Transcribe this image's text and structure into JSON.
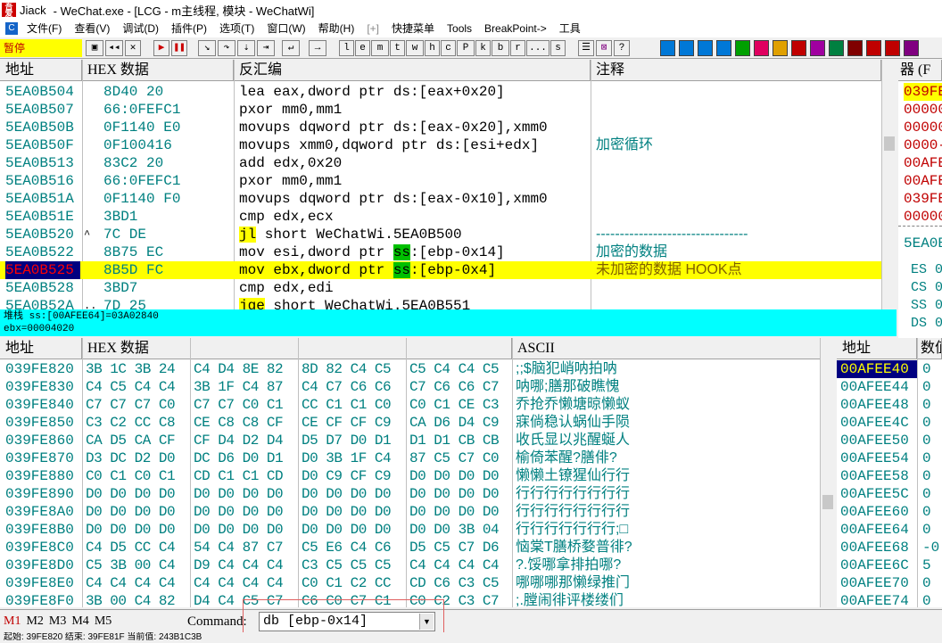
{
  "title": {
    "app": "Jiack",
    "text": "- WeChat.exe - [LCG - m主线程, 模块 - WeChatWi]"
  },
  "menu": [
    {
      "label": "文件(F)"
    },
    {
      "label": "查看(V)"
    },
    {
      "label": "调试(D)"
    },
    {
      "label": "插件(P)"
    },
    {
      "label": "选项(T)"
    },
    {
      "label": "窗口(W)"
    },
    {
      "label": "帮助(H)"
    },
    {
      "label": "[+]"
    },
    {
      "label": "快捷菜单"
    },
    {
      "label": "Tools"
    },
    {
      "label": "BreakPoint->"
    },
    {
      "label": "工具"
    }
  ],
  "toolbar": {
    "pause_label": "暂停",
    "letters": [
      "l",
      "e",
      "m",
      "t",
      "w",
      "h",
      "c",
      "P",
      "k",
      "b",
      "r",
      "...",
      "s"
    ],
    "color_buttons": [
      "#0078d7",
      "#0078d7",
      "#0078d7",
      "#0078d7",
      "#00a000",
      "#e00060",
      "#e0a000",
      "#c00000",
      "#a000a0",
      "#008040",
      "#800000",
      "#c00000",
      "#c00000",
      "#800080"
    ]
  },
  "disasm": {
    "headers": {
      "addr": "地址",
      "hex": "HEX 数据",
      "dis": "反汇编",
      "cmt": "注释"
    },
    "rows": [
      {
        "addr": "5EA0B504",
        "mark": "",
        "hex": "8D40 20",
        "dis": "lea eax,dword ptr ds:[eax+0x20]",
        "cmt": ""
      },
      {
        "addr": "5EA0B507",
        "mark": "",
        "hex": "66:0FEFC1",
        "dis": "pxor mm0,mm1",
        "cmt": ""
      },
      {
        "addr": "5EA0B50B",
        "mark": "",
        "hex": "0F1140 E0",
        "dis": "movups dqword ptr ds:[eax-0x20],xmm0",
        "cmt": ""
      },
      {
        "addr": "5EA0B50F",
        "mark": "",
        "hex": "0F100416",
        "dis": "movups xmm0,dqword ptr ds:[esi+edx]",
        "cmt": "加密循环"
      },
      {
        "addr": "5EA0B513",
        "mark": "",
        "hex": "83C2 20",
        "dis": "add edx,0x20",
        "cmt": ""
      },
      {
        "addr": "5EA0B516",
        "mark": "",
        "hex": "66:0FEFC1",
        "dis": "pxor mm0,mm1",
        "cmt": ""
      },
      {
        "addr": "5EA0B51A",
        "mark": "",
        "hex": "0F1140 F0",
        "dis": "movups dqword ptr ds:[eax-0x10],xmm0",
        "cmt": ""
      },
      {
        "addr": "5EA0B51E",
        "mark": "",
        "hex": "3BD1",
        "dis": "cmp edx,ecx",
        "cmt": ""
      },
      {
        "addr": "5EA0B520",
        "mark": "^",
        "hex": "7C DE",
        "dis_op": "jl",
        "dis_rest": " short WeChatWi.5EA0B500",
        "cmt": "--------------------------------"
      },
      {
        "addr": "5EA0B522",
        "mark": "",
        "hex": "8B75 EC",
        "dis_pre": "mov esi,dword ptr ",
        "dis_seg": "ss",
        "dis_post": ":[ebp-0x14]",
        "cmt": "加密的数据"
      },
      {
        "addr": "5EA0B525",
        "mark": "",
        "hex": "8B5D FC",
        "dis_pre": "mov ebx,dword ptr ",
        "dis_seg": "ss",
        "dis_post": ":[ebp-0x4]",
        "cmt": "未加密的数据 HOOK点",
        "selected": true
      },
      {
        "addr": "5EA0B528",
        "mark": "",
        "hex": "3BD7",
        "dis": "cmp edx,edi",
        "cmt": ""
      },
      {
        "addr": "5EA0B52A",
        "mark": "..",
        "hex": "7D 25",
        "dis_op": "jge",
        "dis_rest": " short WeChatWi.5EA0B551",
        "cmt": ""
      }
    ]
  },
  "info": {
    "line1": "堆栈 ss:[00AFEE64]=03A02840",
    "line2": "ebx=00004020"
  },
  "registers": {
    "header": "器 (F",
    "values": [
      {
        "text": "039FE",
        "color": "#c00000",
        "bg": "#ffff00"
      },
      {
        "text": "00000",
        "color": "#c00000"
      },
      {
        "text": "00000",
        "color": "#c00000"
      },
      {
        "text": "0000-",
        "color": "#c00000"
      },
      {
        "text": "00AFE",
        "color": "#c00000"
      },
      {
        "text": "00AFE",
        "color": "#c00000"
      },
      {
        "text": "039FE",
        "color": "#c00000"
      },
      {
        "text": "00000",
        "color": "#c00000"
      }
    ],
    "eip": "5EA0B",
    "segs": [
      "ES 0",
      "CS 0",
      "SS 0",
      "DS 0"
    ]
  },
  "dump": {
    "headers": {
      "addr": "地址",
      "hex": "HEX 数据",
      "ascii": "ASCII"
    },
    "rows": [
      {
        "addr": "039FE820",
        "hex": [
          "3B 1C 3B 24",
          "C4 D4 8E 82",
          "8D 82 C4 C5",
          "C5 C4 C4 C5"
        ],
        "ascii": ";;$脑犯峭呐拍呐"
      },
      {
        "addr": "039FE830",
        "hex": [
          "C4 C5 C4 C4",
          "3B 1F C4 87",
          "C4 C7 C6 C6",
          "C7 C6 C6 C7"
        ],
        "ascii": "呐哪;膳那破瞧愧"
      },
      {
        "addr": "039FE840",
        "hex": [
          "C7 C7 C7 C0",
          "C7 C7 C0 C1",
          "CC C1 C1 C0",
          "C0 C1 CE C3"
        ],
        "ascii": "乔抢乔懒塘晾懒蚁"
      },
      {
        "addr": "039FE850",
        "hex": [
          "C3 C2 CC C8",
          "CE C8 C8 CF",
          "CE CF CF C9",
          "CA D6 D4 C9"
        ],
        "ascii": "寐倘稳认蜗仙手陨"
      },
      {
        "addr": "039FE860",
        "hex": [
          "CA D5 CA CF",
          "CF D4 D2 D4",
          "D5 D7 D0 D1",
          "D1 D1 CB CB"
        ],
        "ascii": "收氏显以兆醒蜒人"
      },
      {
        "addr": "039FE870",
        "hex": [
          "D3 DC D2 D0",
          "DC D6 D0 D1",
          "D0 3B 1F C4",
          "87 C5 C7 C0"
        ],
        "ascii": "榆倚苯醒?膳俳?"
      },
      {
        "addr": "039FE880",
        "hex": [
          "C0 C1 C0 C1",
          "CD C1 C1 CD",
          "D0 C9 CF C9",
          "D0 D0 D0 D0"
        ],
        "ascii": "懒懒土镣猩仙行行"
      },
      {
        "addr": "039FE890",
        "hex": [
          "D0 D0 D0 D0",
          "D0 D0 D0 D0",
          "D0 D0 D0 D0",
          "D0 D0 D0 D0"
        ],
        "ascii": "行行行行行行行行"
      },
      {
        "addr": "039FE8A0",
        "hex": [
          "D0 D0 D0 D0",
          "D0 D0 D0 D0",
          "D0 D0 D0 D0",
          "D0 D0 D0 D0"
        ],
        "ascii": "行行行行行行行行"
      },
      {
        "addr": "039FE8B0",
        "hex": [
          "D0 D0 D0 D0",
          "D0 D0 D0 D0",
          "D0 D0 D0 D0",
          "D0 D0 3B 04"
        ],
        "ascii": "行行行行行行行;□"
      },
      {
        "addr": "039FE8C0",
        "hex": [
          "C4 D5 CC C4",
          "54 C4 87 C7",
          "C5 E6 C4 C6",
          "D5 C5 C7 D6"
        ],
        "ascii": "恼棠T膳桥婺普徘?"
      },
      {
        "addr": "039FE8D0",
        "hex": [
          "C5 3B 00 C4",
          "D9 C4 C4 C4",
          "C3 C5 C5 C5",
          "C4 C4 C4 C4"
        ],
        "ascii": "?.馁哪拿排拍哪?"
      },
      {
        "addr": "039FE8E0",
        "hex": [
          "C4 C4 C4 C4",
          "C4 C4 C4 C4",
          "C0 C1 C2 CC",
          "CD C6 C3 C5"
        ],
        "ascii": "哪哪哪那懒绿推门"
      },
      {
        "addr": "039FE8F0",
        "hex": [
          "3B 00 C4 82",
          "D4 C4 C5 C7",
          "C6 C0 C7 C1",
          "C0 C2 C3 C7"
        ],
        "ascii": ";.膛闹徘评楼缕们"
      }
    ]
  },
  "stack": {
    "headers": {
      "addr": "地址",
      "val": "数值"
    },
    "rows": [
      {
        "addr": "00AFEE40",
        "val": "0",
        "selected": true
      },
      {
        "addr": "00AFEE44",
        "val": "0"
      },
      {
        "addr": "00AFEE48",
        "val": "0"
      },
      {
        "addr": "00AFEE4C",
        "val": "0"
      },
      {
        "addr": "00AFEE50",
        "val": "0"
      },
      {
        "addr": "00AFEE54",
        "val": "0"
      },
      {
        "addr": "00AFEE58",
        "val": "0"
      },
      {
        "addr": "00AFEE5C",
        "val": "0"
      },
      {
        "addr": "00AFEE60",
        "val": "0"
      },
      {
        "addr": "00AFEE64",
        "val": "0"
      },
      {
        "addr": "00AFEE68",
        "val": "-0"
      },
      {
        "addr": "00AFEE6C",
        "val": "5"
      },
      {
        "addr": "00AFEE70",
        "val": "0"
      },
      {
        "addr": "00AFEE74",
        "val": "0"
      }
    ]
  },
  "command": {
    "tabs": [
      {
        "label": "M1",
        "active": true
      },
      {
        "label": "M2"
      },
      {
        "label": "M3"
      },
      {
        "label": "M4"
      },
      {
        "label": "M5"
      }
    ],
    "label": "Command:",
    "value": "db [ebp-0x14]"
  },
  "status": {
    "text": "起始: 39FE820 结束: 39FE81F 当前值: 243B1C3B"
  },
  "colors": {
    "accent": "#00ffff",
    "selection": "#ffff00",
    "addr": "#008080",
    "highlight_border": "#e06060"
  }
}
